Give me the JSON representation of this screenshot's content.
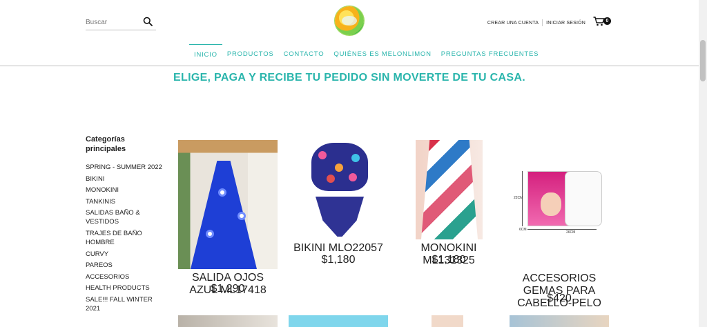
{
  "search": {
    "placeholder": "Buscar"
  },
  "header": {
    "logo_alt": "melonlimon-logo",
    "create_account": "CREAR UNA CUENTA",
    "login": "INICIAR SESIÓN",
    "cart_count": "0"
  },
  "nav": {
    "items": [
      {
        "label": "INICIO",
        "active": true
      },
      {
        "label": "PRODUCTOS"
      },
      {
        "label": "CONTACTO"
      },
      {
        "label": "QUIÉNES ES MELONLIMON"
      },
      {
        "label": "PREGUNTAS FRECUENTES"
      }
    ]
  },
  "promo": "ELIGE, PAGA Y RECIBE TU PEDIDO SIN MOVERTE DE TU CASA.",
  "categories": {
    "title": "Categorías principales",
    "items": [
      "SPRING - SUMMER 2022",
      "BIKINI",
      "MONOKINI",
      "TANKINIS",
      "SALIDAS BAÑO & VESTIDOS",
      "TRAJES DE BAÑO HOMBRE",
      "CURVY",
      "PAREOS",
      "ACCESORIOS",
      "HEALTH PRODUCTS",
      "SALE!!! FALL WINTER 2021"
    ]
  },
  "products": [
    {
      "name": "SALIDA OJOS AZUL ML17418",
      "price": "$1,290"
    },
    {
      "name": "BIKINI MLO22057",
      "price": "$1,180"
    },
    {
      "name": "MONOKINI ML131325",
      "price": "$1,180"
    },
    {
      "name": "ACCESORIOS GEMAS PARA CABELLO-PELO",
      "price": "$420"
    }
  ],
  "product4_labels": {
    "width": "26CM",
    "height": "22CM",
    "depth": "6CM"
  },
  "colors": {
    "accent": "#2ab5ac",
    "text": "#222222"
  }
}
